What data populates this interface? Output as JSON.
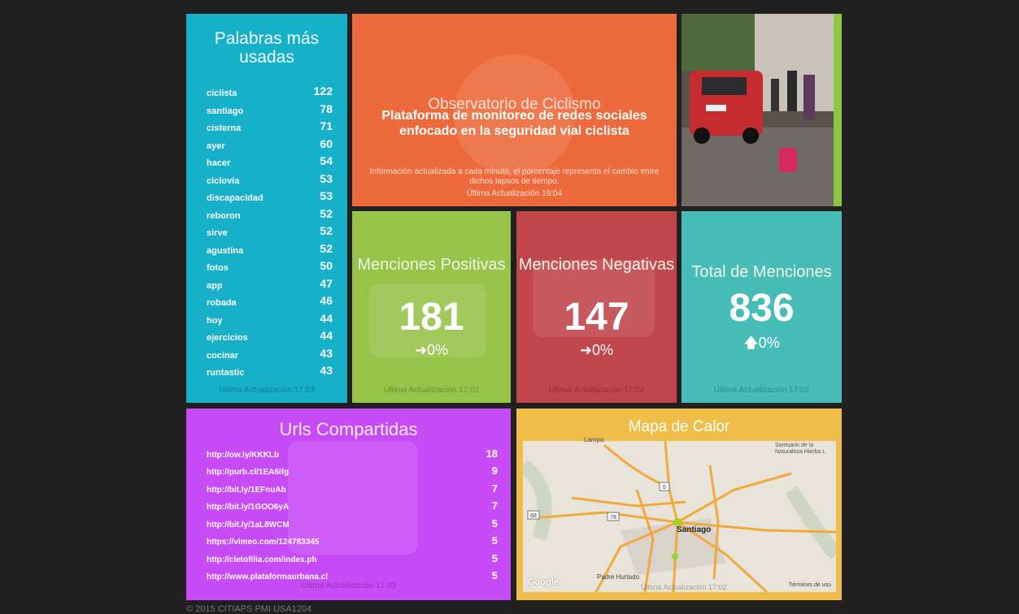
{
  "words": {
    "title": "Palabras más usadas",
    "items": [
      {
        "word": "ciclista",
        "count": "122"
      },
      {
        "word": "santiago",
        "count": "78"
      },
      {
        "word": "cisterna",
        "count": "71"
      },
      {
        "word": "ayer",
        "count": "60"
      },
      {
        "word": "hacer",
        "count": "54"
      },
      {
        "word": "ciclovia",
        "count": "53"
      },
      {
        "word": "discapacidad",
        "count": "53"
      },
      {
        "word": "reboron",
        "count": "52"
      },
      {
        "word": "sirve",
        "count": "52"
      },
      {
        "word": "agustina",
        "count": "52"
      },
      {
        "word": "fotos",
        "count": "50"
      },
      {
        "word": "app",
        "count": "47"
      },
      {
        "word": "robada",
        "count": "46"
      },
      {
        "word": "hoy",
        "count": "44"
      },
      {
        "word": "ejercicios",
        "count": "44"
      },
      {
        "word": "cocinar",
        "count": "43"
      },
      {
        "word": "runtastic",
        "count": "43"
      }
    ],
    "updated": "Última Actualización 17:03"
  },
  "observatorio": {
    "title": "Observatorio de Ciclismo",
    "subtitle": "Plataforma de monitoreo de redes sociales enfocado en la seguridad vial ciclista",
    "info": "Información actualizada a cada minuto, el porcentaje representa el cambio entre dichos lapsos de tiempo.",
    "updated": "Última Actualización 19:04"
  },
  "positive": {
    "title": "Menciones Positivas",
    "value": "181",
    "change": "0%",
    "change_icon": "arrow-right-icon",
    "updated": "Última Actualización 17:02"
  },
  "negative": {
    "title": "Menciones Negativas",
    "value": "147",
    "change": "0%",
    "change_icon": "arrow-right-icon",
    "updated": "Última Actualización 17:02"
  },
  "total": {
    "title": "Total de Menciones",
    "value": "836",
    "change": "0%",
    "change_icon": "arrow-up-icon",
    "updated": "Última Actualización 17:02"
  },
  "urls": {
    "title": "Urls Compartidas",
    "items": [
      {
        "url": "http://ow.ly/KKKLb",
        "count": "18"
      },
      {
        "url": "http://purb.cl/1EA6ifg",
        "count": "9"
      },
      {
        "url": "http://bit.ly/1EFnuAb",
        "count": "7"
      },
      {
        "url": "http://bit.ly/1GOO6yA",
        "count": "7"
      },
      {
        "url": "http://bit.ly/1aL8WCM",
        "count": "5"
      },
      {
        "url": "https://vimeo.com/124783345",
        "count": "5"
      },
      {
        "url": "http://cletofilia.com/index.ph",
        "count": "5"
      },
      {
        "url": "http://www.plataformaurbana.cl",
        "count": "5"
      }
    ],
    "updated": "Última Actualización 17:03"
  },
  "heatmap": {
    "title": "Mapa de Calor",
    "city_label": "Santiago",
    "place_top": "Lampa",
    "place_right": "Santuario de la Naturaleza Hierba L",
    "place_bottom": "Padre Hurtado",
    "route_68": "68",
    "route_5": "5",
    "route_78": "78",
    "google_label": "Google",
    "terms": "Términos de uso",
    "updated": "Última Actualización 17:02"
  },
  "colors": {
    "words": "#16b0c8",
    "observatorio": "#ec6a3c",
    "positive": "#97c349",
    "negative": "#c1464b",
    "total": "#48bcb7",
    "urls": "#c74bf7",
    "heatmap": "#f1bd49"
  },
  "footer": {
    "copyright": "© 2015 CITIAPS PMI USA1204"
  }
}
